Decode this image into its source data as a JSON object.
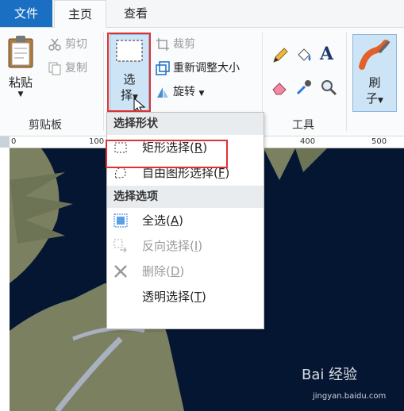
{
  "tabs": {
    "file": "文件",
    "home": "主页",
    "view": "查看"
  },
  "clipboard": {
    "paste": "粘贴",
    "cut": "剪切",
    "copy": "复制",
    "group": "剪贴板"
  },
  "image_group": {
    "select_line1": "选",
    "select_line2": "择",
    "crop": "裁剪",
    "resize": "重新调整大小",
    "rotate": "旋转"
  },
  "tools": {
    "group": "工具",
    "brush_line1": "刷",
    "brush_line2": "子"
  },
  "ruler": {
    "ticks": [
      "0",
      "100",
      "400",
      "500"
    ]
  },
  "menu": {
    "head_shape": "选择形状",
    "rect_prefix": "矩形选择(",
    "rect_key": "R",
    "rect_suffix": ")",
    "free_prefix": "自由图形选择(",
    "free_key": "F",
    "free_suffix": ")",
    "head_options": "选择选项",
    "all_prefix": "全选(",
    "all_key": "A",
    "all_suffix": ")",
    "invert_prefix": "反向选择(",
    "invert_key": "I",
    "invert_suffix": ")",
    "delete_prefix": "删除(",
    "delete_key": "D",
    "delete_suffix": ")",
    "trans_prefix": "透明选择(",
    "trans_key": "T",
    "trans_suffix": ")"
  },
  "watermark": {
    "brand": "Bai 经验",
    "url": "jingyan.baidu.com"
  },
  "colors": {
    "accent": "#1a6fc2",
    "highlight": "#e03131",
    "image_bg": "#051633",
    "leaf": "#7a8060"
  }
}
